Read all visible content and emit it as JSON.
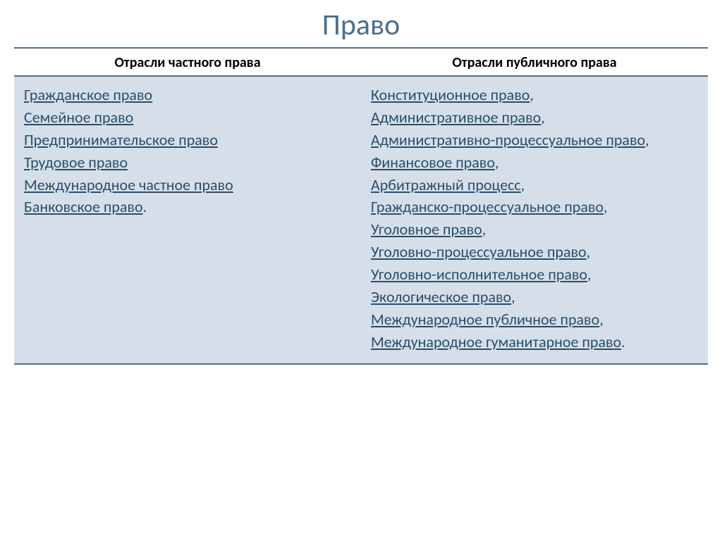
{
  "title": "Право",
  "columns": {
    "left_header": "Отрасли частного права",
    "right_header": "Отрасли публичного права"
  },
  "private_law": {
    "items": [
      "Гражданское право",
      "Семейное право",
      "Предпринимательское право",
      "Трудовое право",
      "Международное частное право",
      "Банковское право"
    ],
    "trailing": "."
  },
  "public_law": {
    "items": [
      "Конституционное право",
      "Административное право",
      "Административно-процессуальное право",
      "Финансовое право",
      "Арбитражный процесс",
      "Гражданско-процессуальное право",
      "Уголовное право",
      "Уголовно-процессуальное право",
      "Уголовно-исполнительное право",
      "Экологическое право",
      "Международное публичное право",
      "Международное гуманитарное право"
    ],
    "separator": ",",
    "trailing": "."
  }
}
